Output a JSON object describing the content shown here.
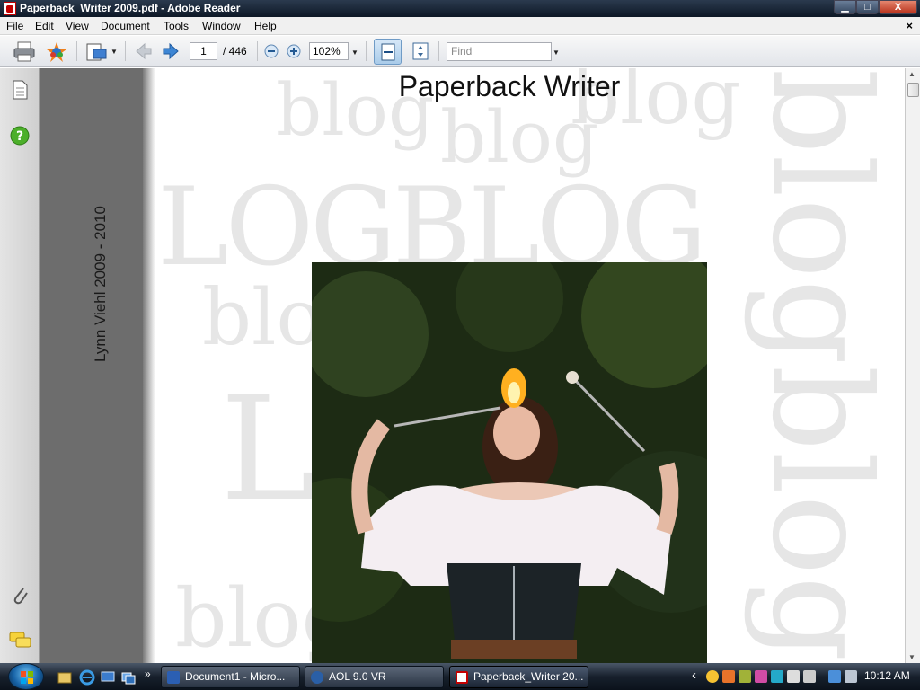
{
  "window": {
    "title": "Paperback_Writer 2009.pdf - Adobe Reader",
    "min_glyph": "▁",
    "max_glyph": "□",
    "close_glyph": "X"
  },
  "menu": {
    "items": [
      "File",
      "Edit",
      "View",
      "Document",
      "Tools",
      "Window",
      "Help"
    ],
    "doc_close": "×"
  },
  "toolbar": {
    "current_page": "1",
    "page_total": "/ 446",
    "zoom": "102%",
    "find_placeholder": "Find"
  },
  "document": {
    "title": "Paperback Writer",
    "vertical_label": "Lynn Viehl 2009 - 2010"
  },
  "taskbar": {
    "buttons": [
      {
        "label": "Document1 - Micro..."
      },
      {
        "label": "AOL 9.0 VR"
      },
      {
        "label": "Paperback_Writer 20..."
      }
    ],
    "quick_launch_more": "»",
    "tray_chevron": "‹",
    "clock": "10:12 AM"
  },
  "colors": {
    "titlebar": "#0d1826",
    "nav_panel": "#d6d6d6",
    "doc_margin_gray": "#6d6d6d",
    "bg_word_gray": "#e6e6e6",
    "taskbar": "#17202c"
  }
}
